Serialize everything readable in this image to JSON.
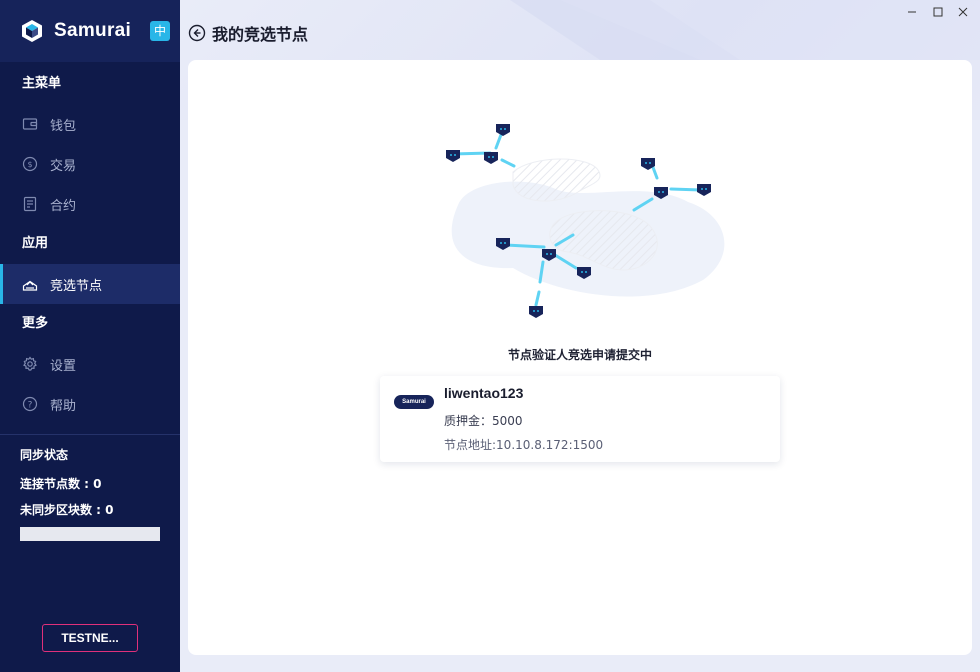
{
  "app": {
    "name": "Samurai",
    "lang_badge": "中"
  },
  "sidebar": {
    "sections": {
      "main": "主菜单",
      "apps": "应用",
      "more": "更多"
    },
    "items": [
      {
        "label": "钱包",
        "icon": "wallet-icon"
      },
      {
        "label": "交易",
        "icon": "exchange-icon"
      },
      {
        "label": "合约",
        "icon": "contract-icon"
      },
      {
        "label": "竞选节点",
        "icon": "vote-icon",
        "active": true
      },
      {
        "label": "设置",
        "icon": "gear-icon"
      },
      {
        "label": "帮助",
        "icon": "help-icon"
      }
    ],
    "sync": {
      "title": "同步状态",
      "connected_nodes": "连接节点数 : 0",
      "unsynced_blocks": "未同步区块数 : 0"
    },
    "network_button": "TESTNE..."
  },
  "header": {
    "title": "我的竞选节点"
  },
  "main": {
    "status_text": "节点验证人竞选申请提交中",
    "node": {
      "logo_text": "Samurai",
      "name": "liwentao123",
      "stake": "质押金：5000",
      "address": "节点地址:10.10.8.172:1500"
    }
  },
  "colors": {
    "sidebar_bg": "#0f1a4a",
    "accent": "#29b6e8",
    "network_border": "#e0307a"
  }
}
